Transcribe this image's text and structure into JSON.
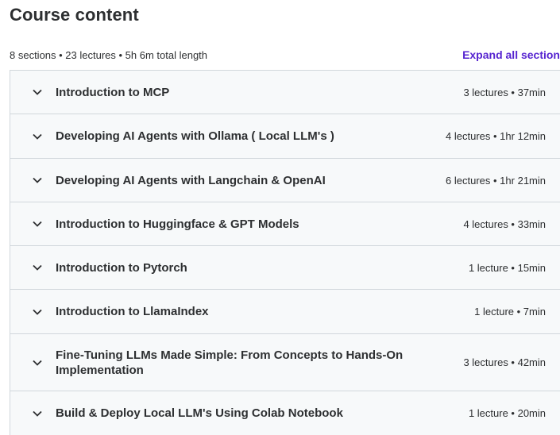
{
  "header": {
    "title": "Course content",
    "summary": "8 sections • 23 lectures • 5h 6m total length",
    "expand_all_label": "Expand all section"
  },
  "colors": {
    "accent": "#5624d0",
    "row_background": "#f7f9fa",
    "border": "#d1d7dc",
    "text": "#2d2f31"
  },
  "sections": [
    {
      "title": "Introduction to MCP",
      "meta": "3 lectures • 37min",
      "icon": "chevron-down-icon"
    },
    {
      "title": "Developing AI Agents with Ollama ( Local LLM's )",
      "meta": "4 lectures • 1hr 12min",
      "icon": "chevron-down-icon"
    },
    {
      "title": "Developing AI Agents with Langchain & OpenAI",
      "meta": "6 lectures • 1hr 21min",
      "icon": "chevron-down-icon"
    },
    {
      "title": "Introduction to Huggingface & GPT Models",
      "meta": "4 lectures • 33min",
      "icon": "chevron-down-icon"
    },
    {
      "title": "Introduction to Pytorch",
      "meta": "1 lecture • 15min",
      "icon": "chevron-down-icon"
    },
    {
      "title": "Introduction to LlamaIndex",
      "meta": "1 lecture • 7min",
      "icon": "chevron-down-icon"
    },
    {
      "title": "Fine-Tuning LLMs Made Simple: From Concepts to Hands-On Implementation",
      "meta": "3 lectures • 42min",
      "icon": "chevron-down-icon"
    },
    {
      "title": "Build & Deploy Local LLM's Using Colab Notebook",
      "meta": "1 lecture • 20min",
      "icon": "chevron-down-icon"
    }
  ]
}
